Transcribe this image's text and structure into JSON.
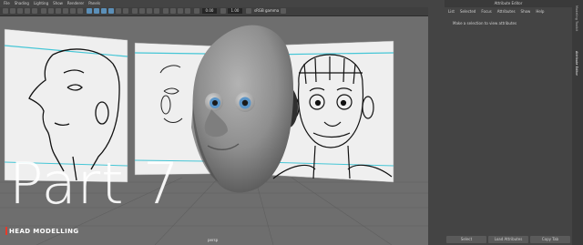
{
  "menubar": [
    "File",
    "Shading",
    "Lighting",
    "Show",
    "Renderer",
    "Panels"
  ],
  "toolbar": {
    "value_1": "0.00",
    "value_2": "1.00",
    "color_space": "sRGB gamma"
  },
  "viewport_label": "persp",
  "overlay": {
    "title": "Part 7",
    "subtitle": "HEAD MODELLING"
  },
  "attribute_editor": {
    "title": "Attribute Editor",
    "menu": [
      "List",
      "Selected",
      "Focus",
      "Attributes",
      "Show",
      "Help"
    ],
    "message": "Make a selection to view attributes",
    "buttons": [
      "Select",
      "Load Attributes",
      "Copy Tab"
    ],
    "side_tabs": [
      "Modeling Toolkit",
      "Attribute Editor"
    ]
  },
  "colors": {
    "viewport_bg": "#6e6e6e",
    "panel_bg": "#444444",
    "guide_line": "#45c6d6",
    "accent_red": "#e53b2c"
  }
}
